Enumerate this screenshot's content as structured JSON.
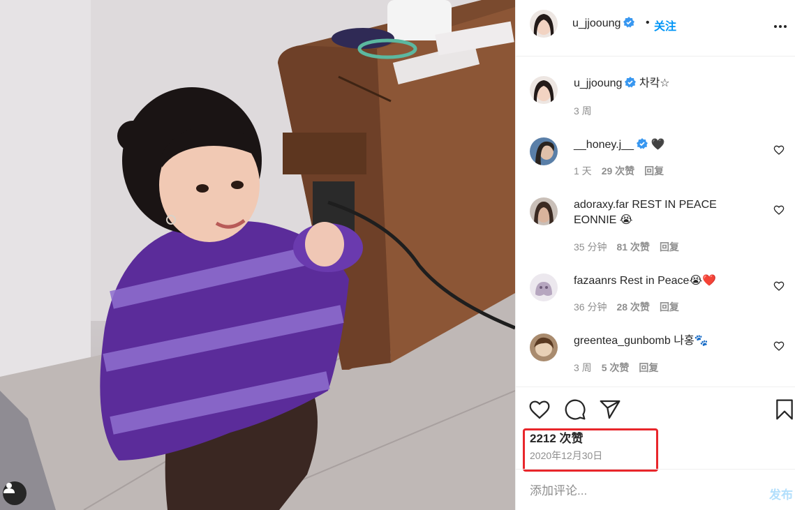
{
  "post": {
    "author": "u_jjooung",
    "follow_label": "关注",
    "separator": "•",
    "caption_author": "u_jjooung",
    "caption_text": "차칵☆",
    "caption_time": "3 周",
    "likes": "2212 次赞",
    "date": "2020年12月30日"
  },
  "comments": [
    {
      "user": "__honey.j__",
      "text": "🖤",
      "time": "1 天",
      "likes": "29 次赞",
      "reply": "回复",
      "verified": true
    },
    {
      "user": "adoraxy.far",
      "text": "REST IN PEACE EONNIE 😭",
      "time": "35 分钟",
      "likes": "81 次赞",
      "reply": "回复",
      "verified": false
    },
    {
      "user": "fazaanrs",
      "text": "Rest in Peace😭❤️",
      "time": "36 分钟",
      "likes": "28 次赞",
      "reply": "回复",
      "verified": false
    },
    {
      "user": "greentea_gunbomb",
      "text": "나홍🐾",
      "time": "3 周",
      "likes": "5 次赞",
      "reply": "回复",
      "verified": false
    }
  ],
  "comment_box": {
    "placeholder": "添加评论...",
    "post_label": "发布"
  },
  "icons": {
    "like": "heart-icon",
    "comment": "comment-icon",
    "share": "paper-plane-icon",
    "save": "bookmark-icon",
    "more": "more-options-icon",
    "verified": "verified-badge-icon",
    "user_tag": "user-tag-icon"
  },
  "colors": {
    "accent": "#0095f6",
    "verified": "#3897f0",
    "highlight_box": "#e8262b",
    "muted_text": "#8e8e8e"
  }
}
